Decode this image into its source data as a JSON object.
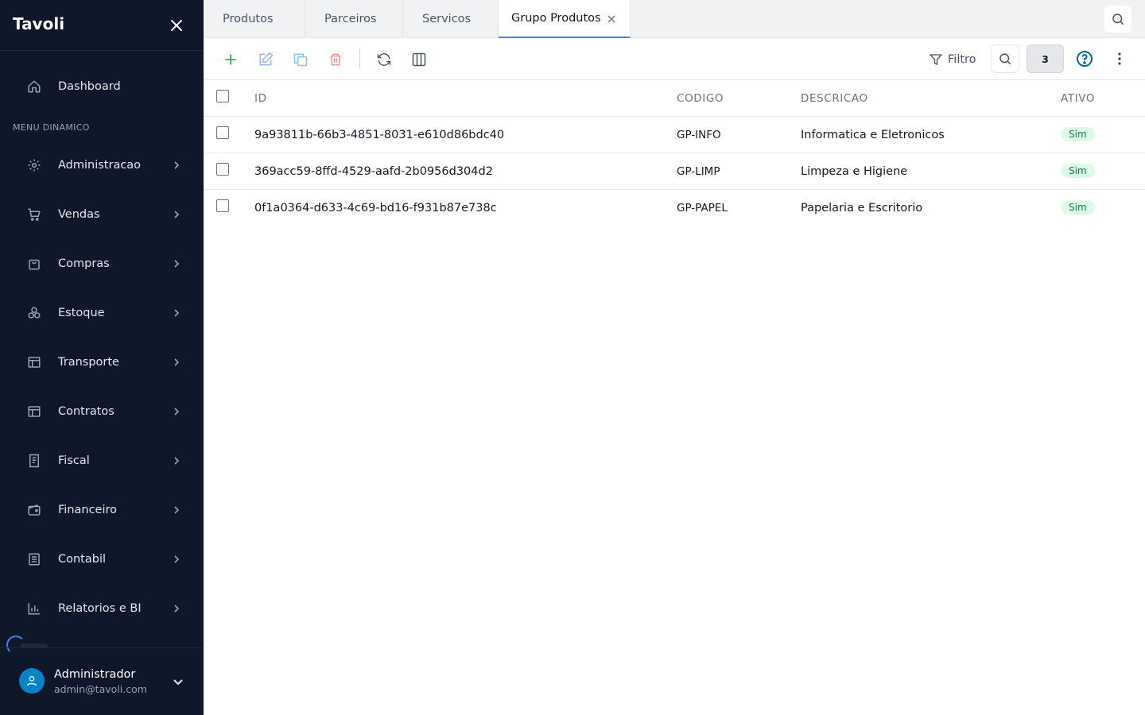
{
  "app": {
    "brand": "Tavoli"
  },
  "sidebar": {
    "dashboard_label": "Dashboard",
    "section_label": "MENU DINAMICO",
    "items": [
      {
        "label": "Administracao",
        "icon": "gear-icon"
      },
      {
        "label": "Vendas",
        "icon": "cart-icon"
      },
      {
        "label": "Compras",
        "icon": "shopping-bag-icon"
      },
      {
        "label": "Estoque",
        "icon": "boxes-icon"
      },
      {
        "label": "Transporte",
        "icon": "layout-icon"
      },
      {
        "label": "Contratos",
        "icon": "layout-icon"
      },
      {
        "label": "Fiscal",
        "icon": "receipt-icon"
      },
      {
        "label": "Financeiro",
        "icon": "wallet-icon"
      },
      {
        "label": "Contabil",
        "icon": "book-icon"
      },
      {
        "label": "Relatorios e BI",
        "icon": "bar-chart-icon"
      }
    ],
    "user": {
      "name": "Administrador",
      "email": "admin@tavoli.com"
    }
  },
  "tabs": [
    {
      "label": "Produtos"
    },
    {
      "label": "Parceiros"
    },
    {
      "label": "Servicos"
    },
    {
      "label": "Grupo Produtos",
      "active": true
    }
  ],
  "toolbar": {
    "filter_label": "Filtro",
    "record_count": "3"
  },
  "table": {
    "columns": [
      "ID",
      "CODIGO",
      "DESCRICAO",
      "ATIVO"
    ],
    "rows": [
      {
        "id": "9a93811b-66b3-4851-8031-e610d86bdc40",
        "codigo": "GP-INFO",
        "descricao": "Informatica e Eletronicos",
        "ativo": "Sim"
      },
      {
        "id": "369acc59-8ffd-4529-aafd-2b0956d304d2",
        "codigo": "GP-LIMP",
        "descricao": "Limpeza e Higiene",
        "ativo": "Sim"
      },
      {
        "id": "0f1a0364-d633-4c69-bd16-f931b87e738c",
        "codigo": "GP-PAPEL",
        "descricao": "Papelaria e Escritorio",
        "ativo": "Sim"
      }
    ]
  },
  "colors": {
    "sidebar_bg": "#0f172a",
    "accent": "#3b82f6",
    "add": "#16a34a",
    "delete": "#ef4444",
    "active_badge": "#15803d"
  }
}
